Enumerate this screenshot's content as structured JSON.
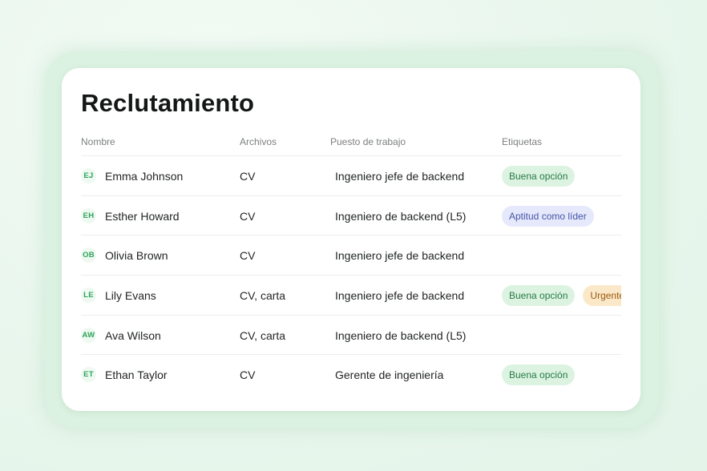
{
  "page": {
    "title": "Reclutamiento"
  },
  "table": {
    "headers": [
      "Nombre",
      "Archivos",
      "Puesto de trabajo",
      "Etiquetas"
    ],
    "rows": [
      {
        "initials": "EJ",
        "name": "Emma Johnson",
        "files": "CV",
        "job": "Ingeniero jefe de backend",
        "tags": [
          {
            "label": "Buena opción",
            "color": "green"
          }
        ]
      },
      {
        "initials": "EH",
        "name": "Esther Howard",
        "files": "CV",
        "job": "Ingeniero de backend (L5)",
        "tags": [
          {
            "label": "Aptitud como líder",
            "color": "blue"
          }
        ]
      },
      {
        "initials": "OB",
        "name": "Olivia Brown",
        "files": "CV",
        "job": "Ingeniero jefe de backend",
        "tags": []
      },
      {
        "initials": "LE",
        "name": "Lily Evans",
        "files": "CV, carta",
        "job": "Ingeniero jefe de backend",
        "tags": [
          {
            "label": "Buena opción",
            "color": "green"
          },
          {
            "label": "Urgente",
            "color": "orange"
          }
        ]
      },
      {
        "initials": "AW",
        "name": "Ava Wilson",
        "files": "CV, carta",
        "job": "Ingeniero de backend (L5)",
        "tags": []
      },
      {
        "initials": "ET",
        "name": "Ethan Taylor",
        "files": "CV",
        "job": "Gerente de ingeniería",
        "tags": [
          {
            "label": "Buena opción",
            "color": "green"
          }
        ]
      }
    ]
  },
  "colors": {
    "tag_green_bg": "#ddf3e2",
    "tag_blue_bg": "#e5e9fb",
    "tag_orange_bg": "#fbe8c9",
    "avatar_text": "#2fa35a"
  }
}
